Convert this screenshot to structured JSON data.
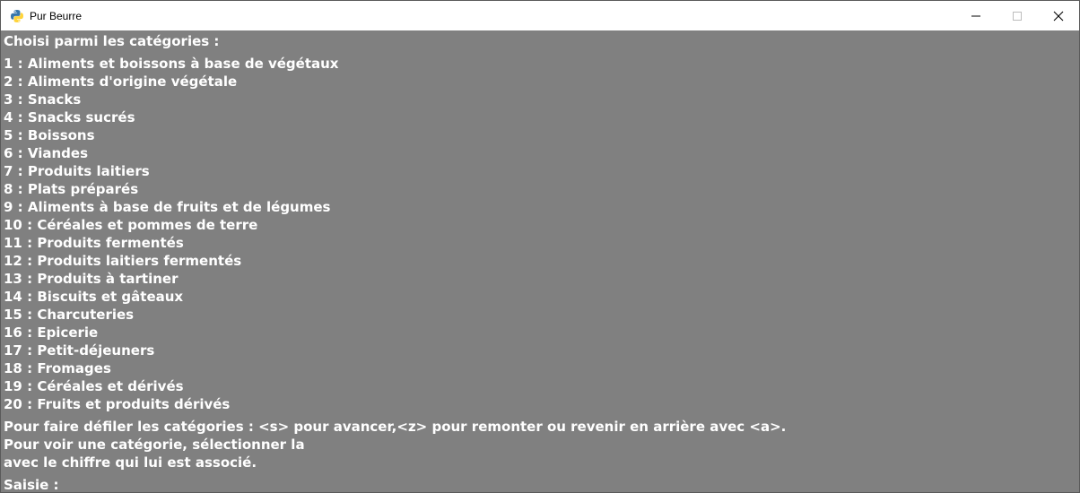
{
  "window": {
    "title": "Pur Beurre",
    "icon": "python-icon",
    "controls": {
      "minimize_icon": "minimize-icon",
      "maximize_icon": "maximize-icon",
      "close_icon": "close-icon"
    },
    "background": "#808080",
    "text_color": "#ffffff"
  },
  "console": {
    "heading": "Choisi parmi les catégories :",
    "categories": [
      "1 : Aliments et boissons à base de végétaux",
      "2 : Aliments d'origine végétale",
      "3 : Snacks",
      "4 : Snacks sucrés",
      "5 : Boissons",
      "6 : Viandes",
      "7 : Produits laitiers",
      "8 : Plats préparés",
      "9 : Aliments à base de fruits et de légumes",
      "10 : Céréales et pommes de terre",
      "11 : Produits fermentés",
      "12 : Produits laitiers fermentés",
      "13 : Produits à tartiner",
      "14 : Biscuits et gâteaux",
      "15 : Charcuteries",
      "16 : Epicerie",
      "17 : Petit-déjeuners",
      "18 : Fromages",
      "19 : Céréales et dérivés",
      "20 : Fruits et produits dérivés"
    ],
    "instructions": [
      "Pour faire défiler les catégories : <s> pour avancer,<z> pour remonter ou revenir en arrière avec <a>.",
      "Pour voir une catégorie, sélectionner la",
      "avec le chiffre qui lui est associé."
    ],
    "prompt": "Saisie :"
  }
}
